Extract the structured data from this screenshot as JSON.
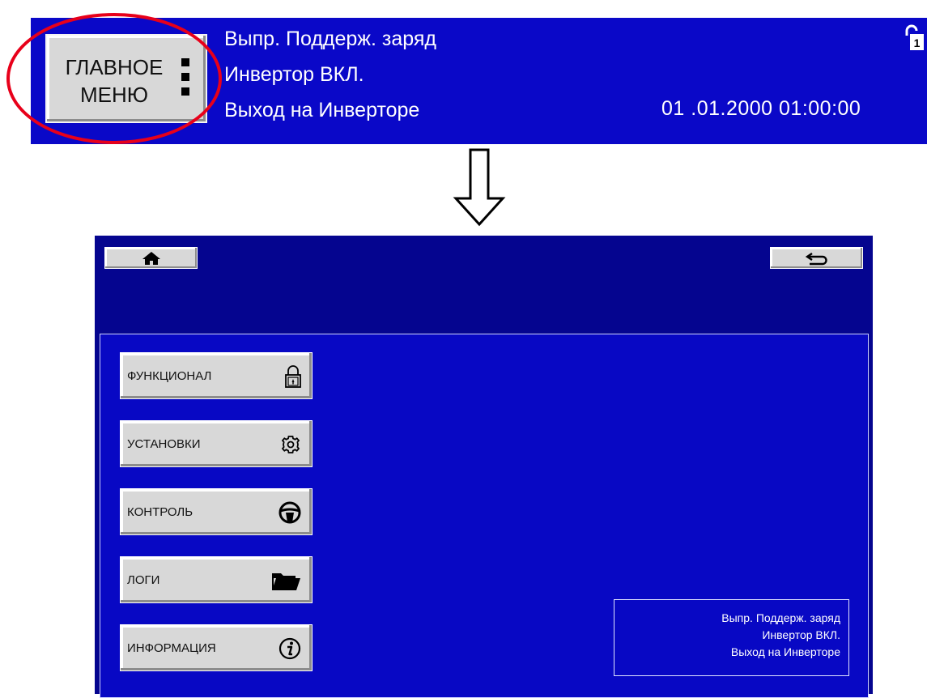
{
  "top_bar": {
    "main_menu": {
      "line1": "ГЛАВНОЕ",
      "line2": "МЕНЮ"
    },
    "status_lines": [
      "Выпр. Поддерж. заряд",
      "Инвертор ВКЛ.",
      "Выход на Инверторе"
    ],
    "datetime": "01 .01.2000  01:00:00",
    "lock_level": "1",
    "highlight_color": "#e8001a"
  },
  "screen": {
    "home_icon": "home-icon",
    "back_icon": "back-arrow-icon",
    "menu_items": [
      {
        "label": "ФУНКЦИОНАЛ",
        "icon": "padlock-icon"
      },
      {
        "label": "УСТАНОВКИ",
        "icon": "gear-icon"
      },
      {
        "label": "КОНТРОЛЬ",
        "icon": "steering-wheel-icon"
      },
      {
        "label": "ЛОГИ",
        "icon": "folder-icon"
      },
      {
        "label": "ИНФОРМАЦИЯ",
        "icon": "info-icon"
      }
    ],
    "status_lines": [
      "Выпр. Поддерж. заряд",
      "Инвертор ВКЛ.",
      "Выход на Инверторе"
    ]
  },
  "colors": {
    "bar_blue": "#0a08c8",
    "screen_blue": "#05058f",
    "button_gray": "#d8d8d8"
  }
}
